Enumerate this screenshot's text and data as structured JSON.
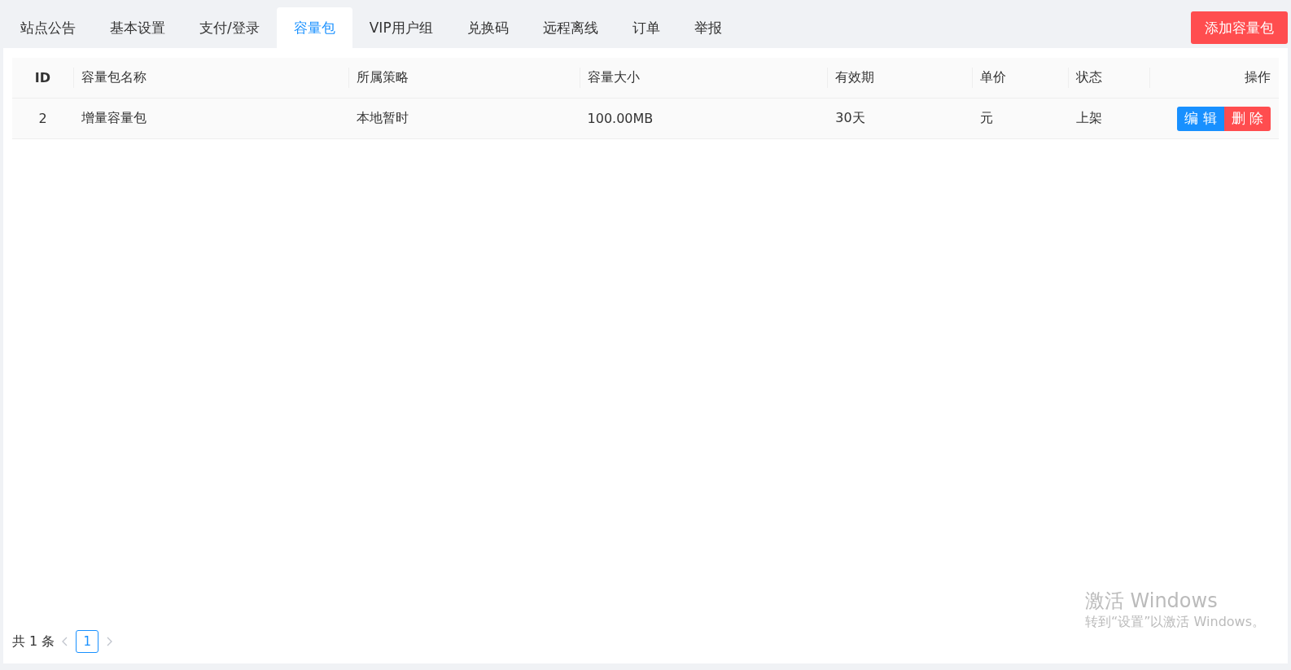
{
  "tabs": [
    {
      "label": "站点公告",
      "selected": false
    },
    {
      "label": "基本设置",
      "selected": false
    },
    {
      "label": "支付/登录",
      "selected": false
    },
    {
      "label": "容量包",
      "selected": true
    },
    {
      "label": "VIP用户组",
      "selected": false
    },
    {
      "label": "兑换码",
      "selected": false
    },
    {
      "label": "远程离线",
      "selected": false
    },
    {
      "label": "订单",
      "selected": false
    },
    {
      "label": "举报",
      "selected": false
    }
  ],
  "add_button": "添加容量包",
  "table": {
    "columns": [
      "ID",
      "容量包名称",
      "所属策略",
      "容量大小",
      "有效期",
      "单价",
      "状态",
      "操作"
    ],
    "rows": [
      {
        "cells": [
          "2",
          "增量容量包",
          "本地暂时",
          "100.00MB",
          "30天",
          "元",
          "上架"
        ],
        "actions": [
          {
            "label": "编 辑",
            "kind": "edit"
          },
          {
            "label": "删 除",
            "kind": "delete"
          }
        ]
      }
    ]
  },
  "pagination": {
    "total": "共 1 条",
    "pages": [
      {
        "label": "1",
        "selected": true
      }
    ]
  },
  "os_overlay": {
    "title": "激活 Windows",
    "subtitle": "转到“设置”以激活 Windows。"
  }
}
